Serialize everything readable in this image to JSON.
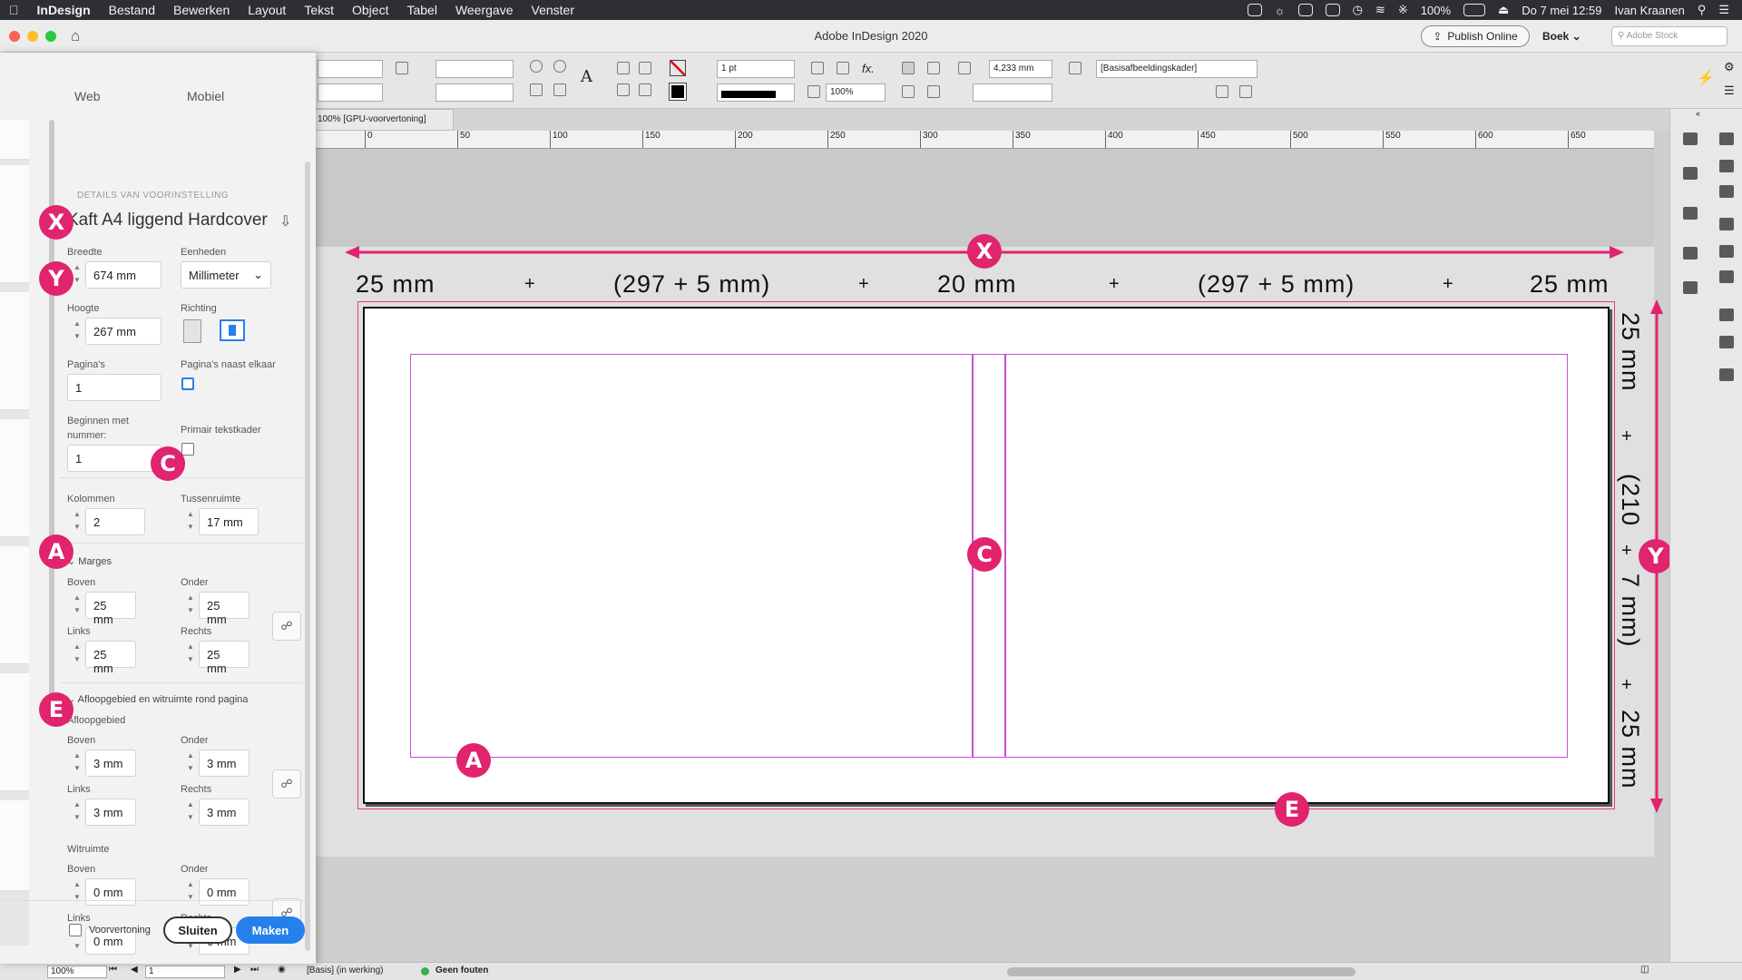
{
  "menubar": {
    "app": "InDesign",
    "items": [
      "Bestand",
      "Bewerken",
      "Layout",
      "Tekst",
      "Object",
      "Tabel",
      "Weergave",
      "Venster"
    ],
    "battery": "100%",
    "datetime": "Do 7 mei  12:59",
    "user": "Ivan Kraanen"
  },
  "window": {
    "title": "Adobe InDesign 2020",
    "publish_label": "Publish Online",
    "workspace": "Boek",
    "stock_placeholder": "Adobe Stock"
  },
  "control": {
    "stroke_weight": "1 pt",
    "opacity": "100%",
    "gutter": "4,233 mm",
    "object_style": "[Basisafbeeldingskader]"
  },
  "doc_tab": "100% [GPU-voorvertoning]",
  "ruler": [
    "0",
    "50",
    "100",
    "150",
    "200",
    "250",
    "300",
    "350",
    "400",
    "450",
    "500",
    "550",
    "600",
    "650"
  ],
  "annotation": {
    "width_parts": [
      "25 mm",
      "+",
      "(297 + 5 mm)",
      "+",
      "20 mm",
      "+",
      "(297 + 5 mm)",
      "+",
      "25 mm"
    ],
    "height_parts": [
      "25 mm",
      "+",
      "(210",
      "+",
      "7 mm)",
      "+",
      "25 mm"
    ],
    "badges": {
      "x": "X",
      "y": "Y",
      "c": "C",
      "a": "A",
      "e": "E"
    },
    "accent_color": "#e0246e"
  },
  "dialog": {
    "tabs": [
      "Web",
      "Mobiel"
    ],
    "section_title": "DETAILS VAN VOORINSTELLING",
    "preset_name": "Kaft A4 liggend Hardcover",
    "width_label": "Breedte",
    "width_value": "674 mm",
    "units_label": "Eenheden",
    "units_value": "Millimeter",
    "height_label": "Hoogte",
    "height_value": "267 mm",
    "orientation_label": "Richting",
    "pages_label": "Pagina's",
    "pages_value": "1",
    "facing_label": "Pagina's naast elkaar",
    "start_label_1": "Beginnen met",
    "start_label_2": "nummer:",
    "start_value": "1",
    "primary_frame_label": "Primair tekstkader",
    "columns_label": "Kolommen",
    "columns_value": "2",
    "gutter_label": "Tussenruimte",
    "gutter_value": "17 mm",
    "margins_title": "Marges",
    "margin_top_label": "Boven",
    "margin_top_value": "25 mm",
    "margin_bottom_label": "Onder",
    "margin_bottom_value": "25 mm",
    "margin_left_label": "Links",
    "margin_left_value": "25 mm",
    "margin_right_label": "Rechts",
    "margin_right_value": "25 mm",
    "bleed_section_title": "Afloopgebied en witruimte rond pagina",
    "bleed_title": "Afloopgebied",
    "bleed_top_label": "Boven",
    "bleed_top_value": "3 mm",
    "bleed_bottom_label": "Onder",
    "bleed_bottom_value": "3 mm",
    "bleed_left_label": "Links",
    "bleed_left_value": "3 mm",
    "bleed_right_label": "Rechts",
    "bleed_right_value": "3 mm",
    "slug_title": "Witruimte",
    "slug_top_label": "Boven",
    "slug_top_value": "0 mm",
    "slug_bottom_label": "Onder",
    "slug_bottom_value": "0 mm",
    "slug_left_label": "Links",
    "slug_left_value": "0 mm",
    "slug_right_label": "Rechts",
    "slug_right_value": "0 mm",
    "preview_label": "Voorvertoning",
    "close_label": "Sluiten",
    "create_label": "Maken"
  },
  "status": {
    "zoom": "100%",
    "page": "1",
    "master": "[Basis] (in werking)",
    "errors": "Geen fouten"
  }
}
